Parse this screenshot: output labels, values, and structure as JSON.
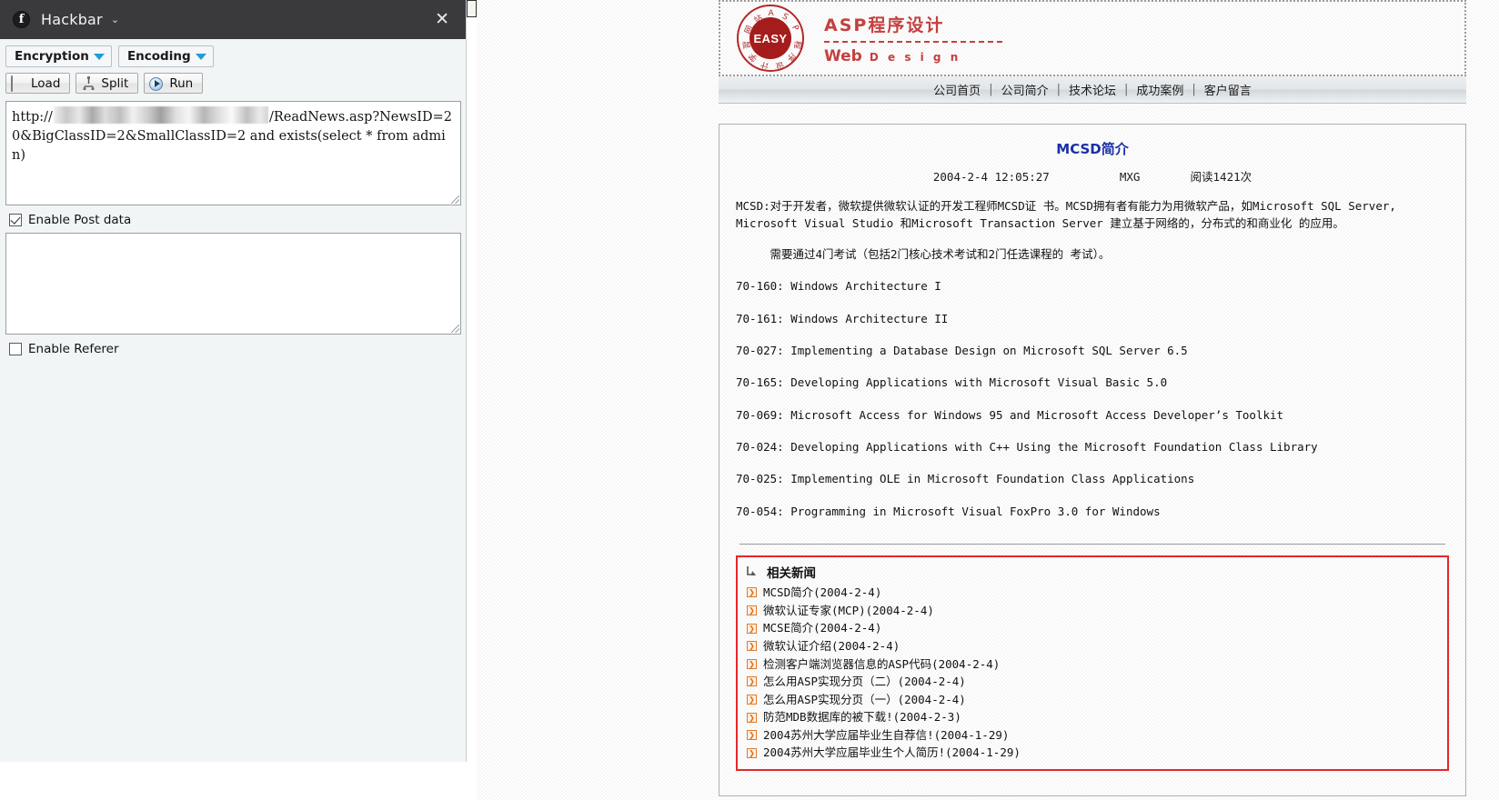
{
  "hackbar": {
    "title": "Hackbar",
    "logo_glyph": "f",
    "caret": "⌄",
    "close_glyph": "✕",
    "dropdowns": [
      {
        "label": "Encryption",
        "name": "encryption"
      },
      {
        "label": "Encoding",
        "name": "encoding"
      }
    ],
    "tools": [
      {
        "label": "Load",
        "name": "load"
      },
      {
        "label": "Split",
        "name": "split"
      },
      {
        "label": "Run",
        "name": "run"
      }
    ],
    "url_field": {
      "prefix": "http://",
      "masked_host": "",
      "suffix": "/ReadNews.asp?NewsID=20&BigClassID=2&SmallClassID=2 and exists(select * from admin)"
    },
    "post_data": {
      "checkbox_label": "Enable Post data",
      "checked": true,
      "value": ""
    },
    "referer": {
      "checkbox_label": "Enable Referer",
      "checked": false
    }
  },
  "webpage": {
    "logo": {
      "stamp_text": "EASY",
      "ring_chars": "A S P 程 序 设 计 学 習 网 站",
      "title": "ASP程序设计",
      "subtitle_main": "Web",
      "subtitle_small": "D e s i g n"
    },
    "nav": {
      "separator": "|",
      "items": [
        "公司首页",
        "公司简介",
        "技术论坛",
        "成功案例",
        "客户留言"
      ]
    },
    "article": {
      "title": "MCSD简介",
      "title_color": "#1b2ea8",
      "date": "2004-2-4 12:05:27",
      "author": "MXG",
      "views": "阅读1421次",
      "paragraph1": "MCSD:对于开发者，微软提供微软认证的开发工程师MCSD证 书。MCSD拥有者有能力为用微软产品，如Microsoft SQL Server, Microsoft Visual Studio 和Microsoft Transaction Server 建立基于网络的，分布式的和商业化 的应用。",
      "paragraph2": "需要通过4门考试（包括2门核心技术考试和2门任选课程的 考试）。",
      "exams": [
        "70-160: Windows Architecture I",
        "70-161: Windows Architecture II",
        "70-027: Implementing a Database Design on Microsoft SQL Server 6.5",
        "70-165: Developing Applications with Microsoft Visual Basic 5.0",
        "70-069: Microsoft Access for Windows 95 and Microsoft Access Developer’s Toolkit",
        "70-024: Developing Applications with C++ Using the Microsoft Foundation Class Library",
        "70-025: Implementing OLE in Microsoft Foundation Class Applications",
        "70-054: Programming in Microsoft Visual FoxPro 3.0 for Windows"
      ]
    },
    "related": {
      "heading": "相关新闻",
      "border_color": "#e8262a",
      "bullet_glyph": "❯",
      "items": [
        "MCSD简介(2004-2-4)",
        "微软认证专家(MCP)(2004-2-4)",
        "MCSE简介(2004-2-4)",
        "微软认证介绍(2004-2-4)",
        "检测客户端浏览器信息的ASP代码(2004-2-4)",
        "怎么用ASP实现分页（二）(2004-2-4)",
        "怎么用ASP实现分页（一）(2004-2-4)",
        "防范MDB数据库的被下载!(2004-2-3)",
        "2004苏州大学应届毕业生自荐信!(2004-1-29)",
        "2004苏州大学应届毕业生个人简历!(2004-1-29)"
      ]
    }
  }
}
